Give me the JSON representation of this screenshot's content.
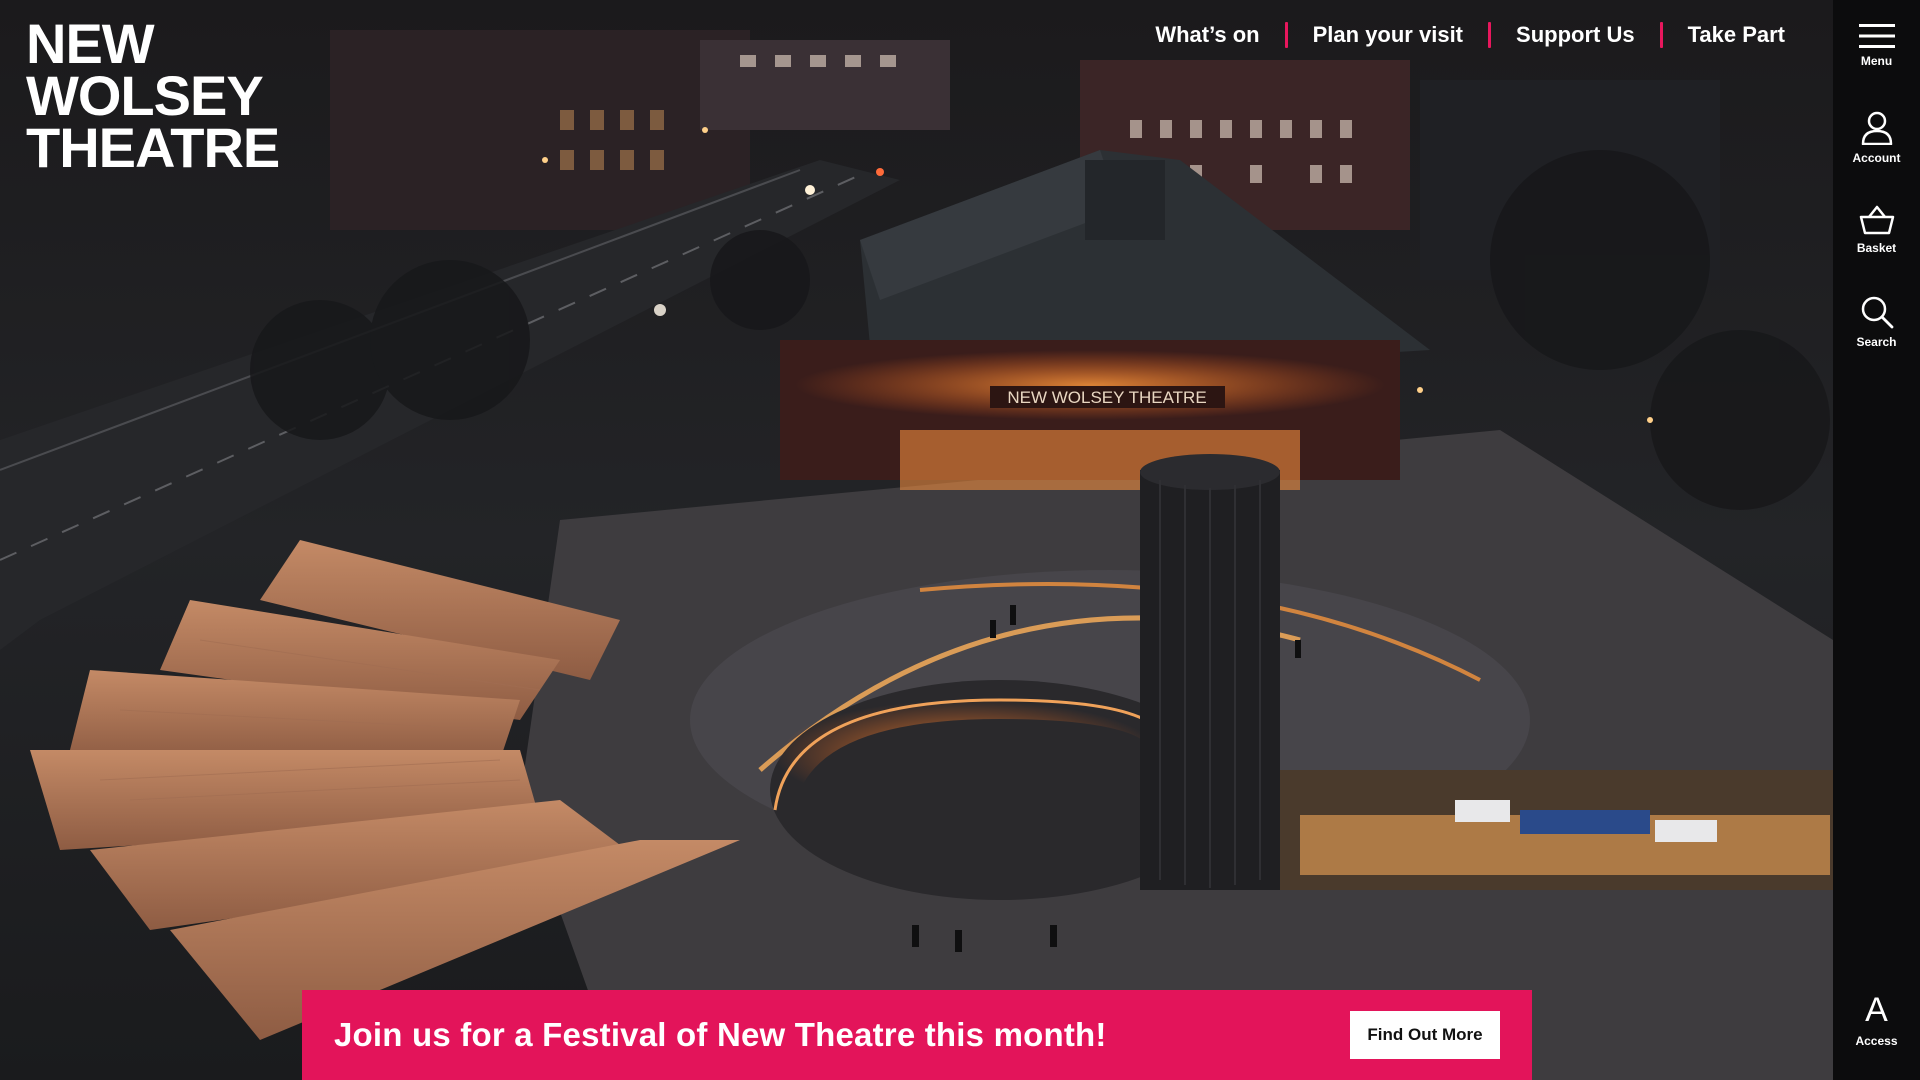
{
  "logo": {
    "line1": "NEW",
    "line2": "WOLSEY",
    "line3": "THEATRE"
  },
  "nav": {
    "items": [
      {
        "label": "What’s on"
      },
      {
        "label": "Plan your visit"
      },
      {
        "label": "Support Us"
      },
      {
        "label": "Take Part"
      }
    ]
  },
  "rail": {
    "menu": {
      "label": "Menu",
      "icon": "hamburger-icon"
    },
    "account": {
      "label": "Account",
      "icon": "user-icon"
    },
    "basket": {
      "label": "Basket",
      "icon": "basket-icon"
    },
    "search": {
      "label": "Search",
      "icon": "search-icon"
    },
    "access": {
      "label": "Access",
      "glyph": "A",
      "icon": "accessibility-icon"
    }
  },
  "hero": {
    "sign_text": "NEW WOLSEY THEATRE"
  },
  "banner": {
    "message": "Join us for a Festival of New Theatre this month!",
    "cta_label": "Find Out More"
  },
  "colors": {
    "accent": "#e3145a",
    "rail_bg": "#0c0c0d"
  }
}
